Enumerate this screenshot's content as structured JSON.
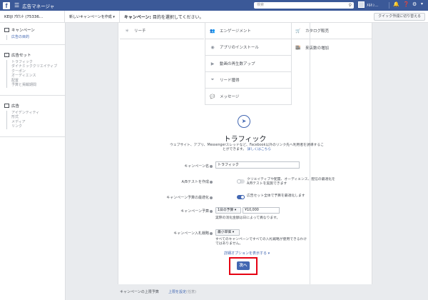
{
  "topbar": {
    "title": "広告マネージャ",
    "search_placeholder": "検索",
    "user_name": "ﾒﾙﾄﾝ..."
  },
  "secbar": {
    "account": "KEIJI ｱｶｳﾝﾄ (75336...",
    "create_dropdown": "新しいキャンペーンを作成 ▾",
    "campaign_label": "キャンペーン:",
    "campaign_prompt": "目的を選択してください。",
    "quick_create": "クイック作成に切り替える"
  },
  "sidebar": {
    "campaign": {
      "head": "キャンペーン",
      "items": [
        "広告の目的"
      ]
    },
    "adset": {
      "head": "広告セット",
      "items": [
        "トラフィック",
        "ダイナミッククリエイティブ",
        "クーポン",
        "オーディエンス",
        "配置",
        "予算と掲載期間"
      ]
    },
    "ad": {
      "head": "広告",
      "items": [
        "アイデンティティ",
        "形式",
        "メディア",
        "リンク"
      ]
    }
  },
  "objectives": {
    "left": [
      "リーチ"
    ],
    "middle": [
      "エンゲージメント",
      "アプリのインストール",
      "動画の再生数アップ",
      "リード獲得",
      "メッセージ"
    ],
    "right": [
      "カタログ販売",
      "来店数の増加"
    ]
  },
  "selected": {
    "title": "トラフィック",
    "description": "ウェブサイト、アプリ、Messengerスレッドなど、Facebook以外のリンク先へ利用者を誘導することができます。",
    "learn_more": "詳しくはこちら"
  },
  "form": {
    "name_label": "キャンペーン名",
    "name_value": "トラフィック",
    "ab_label": "A/Bテストを作成",
    "ab_text": "クリエイティブや配置、オーディエンス、配信の最適化をA/Bテストを実施できます",
    "budget_opt_label": "キャンペーン予算の最適化",
    "budget_opt_text": "広告セット全体で予算を最適化します",
    "budget_label": "キャンペーン予算",
    "budget_type": "1日の予算 ▾",
    "budget_value": "¥10,000",
    "budget_note": "実際の消化金額は日によって異なります。",
    "bid_label": "キャンペーン入札戦略",
    "bid_value": "最小単価 ▾",
    "bid_note": "すべてのキャンペーンですべての入札戦略が使用できるわけではありません。",
    "more_options": "詳細オプションを表示する ▾",
    "next_button": "次へ"
  },
  "footer": {
    "label": "キャンペーンの上限予算",
    "link": "上限を設定",
    "link_suffix": "(任意)"
  },
  "colors": {
    "brand": "#3b5998",
    "accent": "#4267b2",
    "highlight": "#e60012"
  }
}
